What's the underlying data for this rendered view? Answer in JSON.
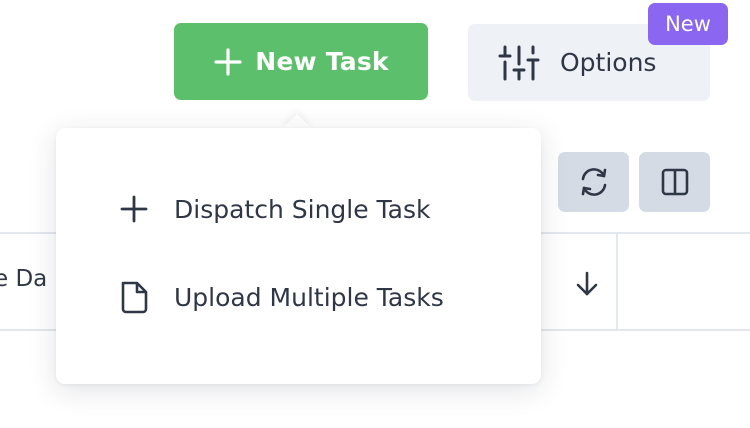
{
  "header": {
    "new_task_label": "New Task",
    "options_label": "Options",
    "new_badge": "New"
  },
  "table": {
    "partial_column_header": "e Da"
  },
  "dropdown": {
    "items": [
      {
        "label": "Dispatch Single Task",
        "icon": "plus-icon"
      },
      {
        "label": "Upload Multiple Tasks",
        "icon": "file-icon"
      }
    ]
  },
  "colors": {
    "primary_green": "#5bbf6b",
    "badge_purple": "#8b66f0",
    "toolbar_button": "#d4dbe5",
    "options_bg": "#eef1f6",
    "text": "#2f3747"
  }
}
